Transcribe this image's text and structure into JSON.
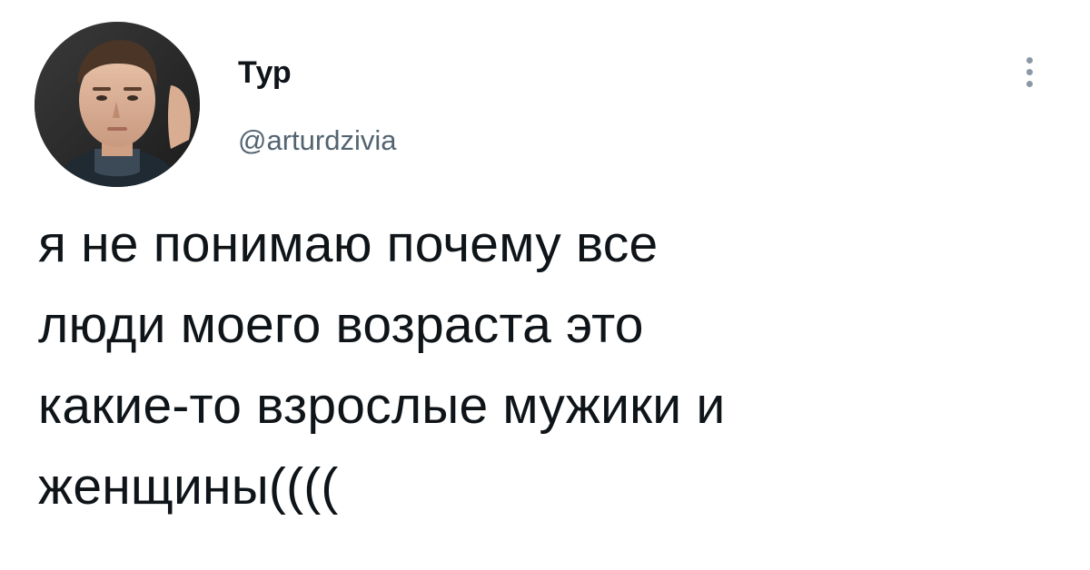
{
  "author": {
    "display_name": "Тур",
    "handle": "@arturdzivia"
  },
  "tweet": {
    "lines": [
      "я не понимаю почему все",
      "люди моего возраста это",
      "какие-то взрослые мужики и",
      "женщины(((("
    ]
  },
  "icons": {
    "more": "more-vertical-icon",
    "avatar": "profile-photo"
  },
  "colors": {
    "text": "#0f1419",
    "secondary_text": "#536471",
    "icon": "#8b98a5",
    "background": "#ffffff"
  }
}
